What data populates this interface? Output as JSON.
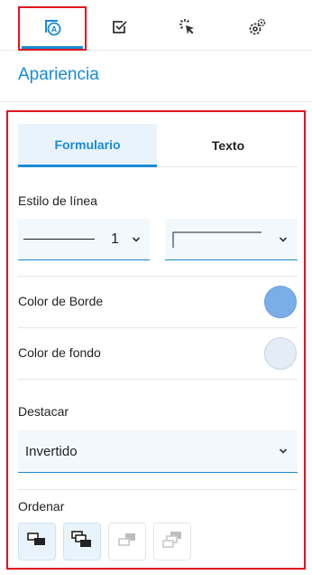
{
  "toolbar": {
    "items": [
      {
        "icon": "appearance-icon",
        "active": true
      },
      {
        "icon": "checkbox-icon",
        "active": false
      },
      {
        "icon": "click-icon",
        "active": false
      },
      {
        "icon": "gears-icon",
        "active": false
      }
    ]
  },
  "section": {
    "title": "Apariencia"
  },
  "tabs": [
    {
      "label": "Formulario",
      "selected": true
    },
    {
      "label": "Texto",
      "selected": false
    }
  ],
  "line_style": {
    "label": "Estilo de línea",
    "width_value": "1"
  },
  "border_color": {
    "label": "Color de Borde",
    "color": "#7aaee8"
  },
  "background_color": {
    "label": "Color de fondo",
    "color": "#e4ecf6"
  },
  "highlight": {
    "label": "Destacar",
    "value": "Invertido"
  },
  "order": {
    "label": "Ordenar"
  },
  "colors": {
    "accent": "#1a8ad6",
    "highlight_outline": "#e0141e"
  }
}
